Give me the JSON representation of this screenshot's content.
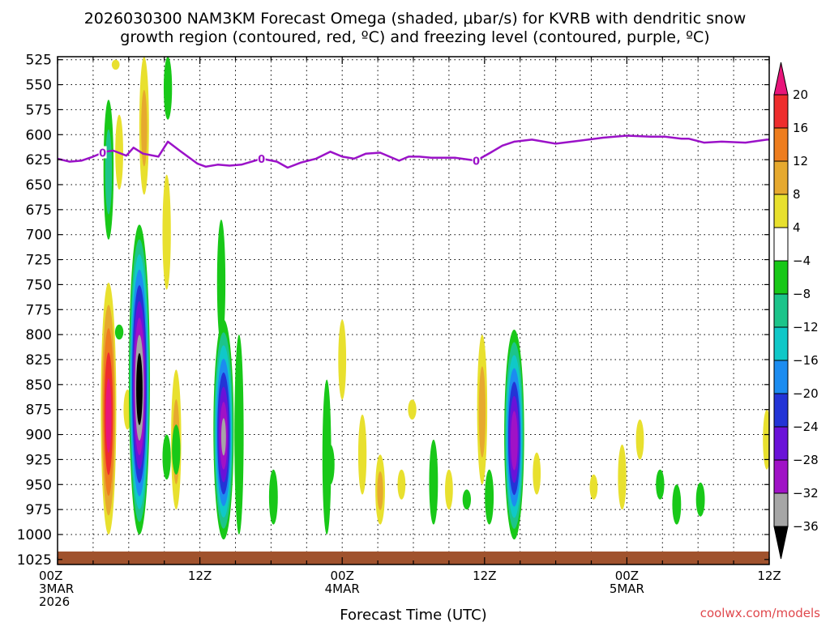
{
  "chart_data": {
    "type": "heatmap",
    "title_lines": [
      "2026030300 NAM3KM Forecast Omega (shaded, μbar/s) for KVRB with dendritic snow",
      "growth region (contoured, red, ºC) and freezing level (contoured, purple, ºC)"
    ],
    "xlabel": "Forecast Time (UTC)",
    "credit": "coolwx.com/models",
    "y_axis": {
      "label": "",
      "reversed": true,
      "ylim": [
        1030,
        522
      ],
      "ticks": [
        "525",
        "550",
        "575",
        "600",
        "625",
        "650",
        "675",
        "700",
        "725",
        "750",
        "775",
        "800",
        "825",
        "850",
        "875",
        "900",
        "925",
        "950",
        "975",
        "1000",
        "1025"
      ]
    },
    "x_axis": {
      "xlim": [
        0,
        60
      ],
      "ticks": [
        {
          "hour": 0,
          "lines": [
            "00Z",
            "3MAR",
            "2026"
          ]
        },
        {
          "hour": 12,
          "lines": [
            "12Z"
          ]
        },
        {
          "hour": 24,
          "lines": [
            "00Z",
            "4MAR"
          ]
        },
        {
          "hour": 36,
          "lines": [
            "12Z"
          ]
        },
        {
          "hour": 48,
          "lines": [
            "00Z",
            "5MAR"
          ]
        },
        {
          "hour": 60,
          "lines": [
            "12Z"
          ]
        }
      ]
    },
    "grid": true,
    "colorbar": {
      "placement": "right",
      "labels": [
        "20",
        "16",
        "12",
        "8",
        "4",
        "−4",
        "−8",
        "−12",
        "−16",
        "−20",
        "−24",
        "−28",
        "−32",
        "−36"
      ],
      "bins": [
        {
          "range": [
            20,
            99
          ],
          "color": "#e8157a"
        },
        {
          "range": [
            16,
            20
          ],
          "color": "#ee2d2d"
        },
        {
          "range": [
            12,
            16
          ],
          "color": "#ee7d1e"
        },
        {
          "range": [
            8,
            12
          ],
          "color": "#e6a92f"
        },
        {
          "range": [
            4,
            8
          ],
          "color": "#e8e02e"
        },
        {
          "range": [
            -4,
            4
          ],
          "color": "#ffffff"
        },
        {
          "range": [
            -8,
            -4
          ],
          "color": "#18c818"
        },
        {
          "range": [
            -12,
            -8
          ],
          "color": "#1cc48a"
        },
        {
          "range": [
            -16,
            -12
          ],
          "color": "#10c8c8"
        },
        {
          "range": [
            -20,
            -16
          ],
          "color": "#1c8cf0"
        },
        {
          "range": [
            -24,
            -20
          ],
          "color": "#2334d6"
        },
        {
          "range": [
            -28,
            -24
          ],
          "color": "#6a12d8"
        },
        {
          "range": [
            -32,
            -28
          ],
          "color": "#a012c6"
        },
        {
          "range": [
            -36,
            -32
          ],
          "color": "#a6a6a6"
        },
        {
          "range": [
            -99,
            -36
          ],
          "color": "#000000"
        }
      ]
    },
    "omega_features": [
      {
        "hour": 4.3,
        "p_top": 565,
        "p_bot": 705,
        "peak": -10
      },
      {
        "hour": 4.3,
        "p_top": 748,
        "p_bot": 1000,
        "peak": 22
      },
      {
        "hour": 4.9,
        "p_top": 525,
        "p_bot": 535,
        "peak": 5
      },
      {
        "hour": 5.2,
        "p_top": 580,
        "p_bot": 655,
        "peak": 5
      },
      {
        "hour": 5.9,
        "p_top": 855,
        "p_bot": 895,
        "peak": 5
      },
      {
        "hour": 5.2,
        "p_top": 790,
        "p_bot": 805,
        "peak": -6
      },
      {
        "hour": 7.3,
        "p_top": 522,
        "p_bot": 660,
        "peak": 9
      },
      {
        "hour": 6.9,
        "p_top": 690,
        "p_bot": 1000,
        "peak": -40
      },
      {
        "hour": 9.3,
        "p_top": 522,
        "p_bot": 585,
        "peak": -6
      },
      {
        "hour": 9.2,
        "p_top": 640,
        "p_bot": 755,
        "peak": 6
      },
      {
        "hour": 9.2,
        "p_top": 900,
        "p_bot": 945,
        "peak": -6
      },
      {
        "hour": 10.0,
        "p_top": 835,
        "p_bot": 975,
        "peak": 10
      },
      {
        "hour": 10.0,
        "p_top": 890,
        "p_bot": 940,
        "peak": -6
      },
      {
        "hour": 13.8,
        "p_top": 685,
        "p_bot": 810,
        "peak": -6
      },
      {
        "hour": 14.0,
        "p_top": 785,
        "p_bot": 1005,
        "peak": -33
      },
      {
        "hour": 15.3,
        "p_top": 800,
        "p_bot": 1000,
        "peak": -8
      },
      {
        "hour": 18.2,
        "p_top": 935,
        "p_bot": 990,
        "peak": -7
      },
      {
        "hour": 22.7,
        "p_top": 845,
        "p_bot": 1000,
        "peak": -7
      },
      {
        "hour": 23.0,
        "p_top": 910,
        "p_bot": 950,
        "peak": -6
      },
      {
        "hour": 24.0,
        "p_top": 785,
        "p_bot": 865,
        "peak": 5
      },
      {
        "hour": 25.7,
        "p_top": 880,
        "p_bot": 960,
        "peak": 6
      },
      {
        "hour": 27.2,
        "p_top": 920,
        "p_bot": 990,
        "peak": 9
      },
      {
        "hour": 29.9,
        "p_top": 865,
        "p_bot": 885,
        "peak": 6
      },
      {
        "hour": 29.0,
        "p_top": 935,
        "p_bot": 965,
        "peak": 5
      },
      {
        "hour": 31.7,
        "p_top": 905,
        "p_bot": 990,
        "peak": -7
      },
      {
        "hour": 33.0,
        "p_top": 935,
        "p_bot": 975,
        "peak": 5
      },
      {
        "hour": 34.5,
        "p_top": 955,
        "p_bot": 975,
        "peak": -6
      },
      {
        "hour": 35.8,
        "p_top": 800,
        "p_bot": 950,
        "peak": 10
      },
      {
        "hour": 36.4,
        "p_top": 935,
        "p_bot": 990,
        "peak": -7
      },
      {
        "hour": 38.5,
        "p_top": 795,
        "p_bot": 1005,
        "peak": -32
      },
      {
        "hour": 40.4,
        "p_top": 918,
        "p_bot": 960,
        "peak": 5
      },
      {
        "hour": 45.2,
        "p_top": 940,
        "p_bot": 965,
        "peak": 5
      },
      {
        "hour": 47.6,
        "p_top": 910,
        "p_bot": 975,
        "peak": 6
      },
      {
        "hour": 49.1,
        "p_top": 885,
        "p_bot": 925,
        "peak": 5
      },
      {
        "hour": 50.8,
        "p_top": 935,
        "p_bot": 965,
        "peak": -6
      },
      {
        "hour": 52.2,
        "p_top": 950,
        "p_bot": 990,
        "peak": -7
      },
      {
        "hour": 54.2,
        "p_top": 948,
        "p_bot": 982,
        "peak": -7
      },
      {
        "hour": 59.8,
        "p_top": 875,
        "p_bot": 935,
        "peak": 5
      }
    ],
    "freezing_level": {
      "label": "0",
      "label_hours": [
        3.8,
        17.2,
        35.3
      ],
      "hours": [
        0,
        1,
        2,
        3,
        4,
        4.7,
        5.8,
        6.4,
        7.2,
        8.5,
        9.3,
        10.3,
        11.8,
        12.5,
        13.5,
        14.5,
        15.5,
        17.2,
        18.5,
        19.4,
        20.5,
        21.8,
        23,
        24,
        25,
        26,
        27.2,
        28.8,
        29.6,
        30.5,
        31.5,
        32.5,
        33.5,
        35.3,
        36.5,
        37.5,
        38.5,
        40.0,
        42.0,
        44.0,
        46.0,
        48.0,
        50.0,
        51.2,
        52.6,
        53.2,
        54.5,
        56.0,
        58.0,
        59.8,
        60.0
      ],
      "pressure": [
        624,
        627,
        626,
        622,
        617,
        616,
        621,
        613,
        619,
        622,
        607,
        616,
        629,
        632,
        630,
        631,
        630,
        624,
        627,
        633,
        628,
        624,
        617,
        622,
        624,
        619,
        618,
        626,
        622,
        622,
        623,
        623,
        623,
        626,
        618,
        611,
        607,
        605,
        609,
        606,
        603,
        601,
        602,
        602,
        604,
        604,
        608,
        607,
        608,
        605,
        605
      ]
    },
    "terrain": {
      "p_top": 1017,
      "p_bottom": 1025
    }
  }
}
